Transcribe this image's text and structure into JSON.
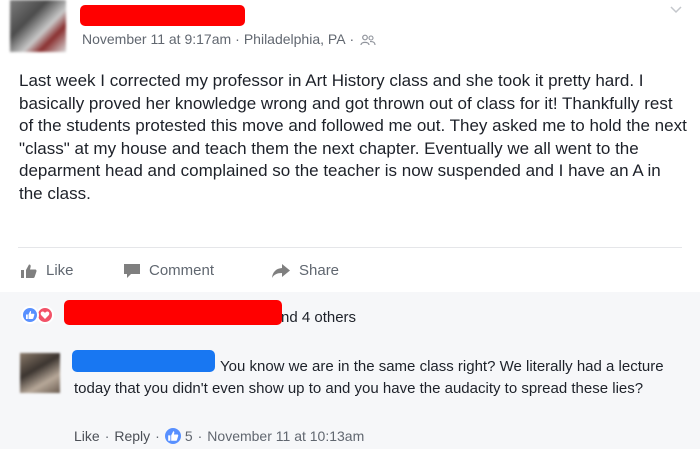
{
  "post": {
    "timestamp": "November 11 at 9:17am",
    "location": "Philadelphia, PA",
    "separator": "·",
    "audience_icon": "friends-icon",
    "body": "Last week I corrected my professor in Art History class and she took it pretty hard. I basically proved her knowledge wrong and got thrown out of class for it! Thankfully rest of the students protested this move and followed me out. They asked me to hold the next \"class\" at my house and teach them the next chapter. Eventually we all went to the deparment head and complained so the teacher is now suspended and I have an A in the class."
  },
  "actions": {
    "like": "Like",
    "comment": "Comment",
    "share": "Share"
  },
  "reactions": {
    "types": [
      "like",
      "love"
    ],
    "others_text": "nd 4 others"
  },
  "comment": {
    "text": "You know we are in the same class right? We literally had a lecture today that you didn't even show up to and you have the audacity to spread these lies?",
    "like_label": "Like",
    "reply_label": "Reply",
    "separator": "·",
    "like_count": "5",
    "timestamp": "November 11 at 10:13am"
  },
  "colors": {
    "redaction_red": "#ff0000",
    "redaction_blue": "#1877f2",
    "like_blue": "#5890ff",
    "love_red": "#f25268"
  }
}
